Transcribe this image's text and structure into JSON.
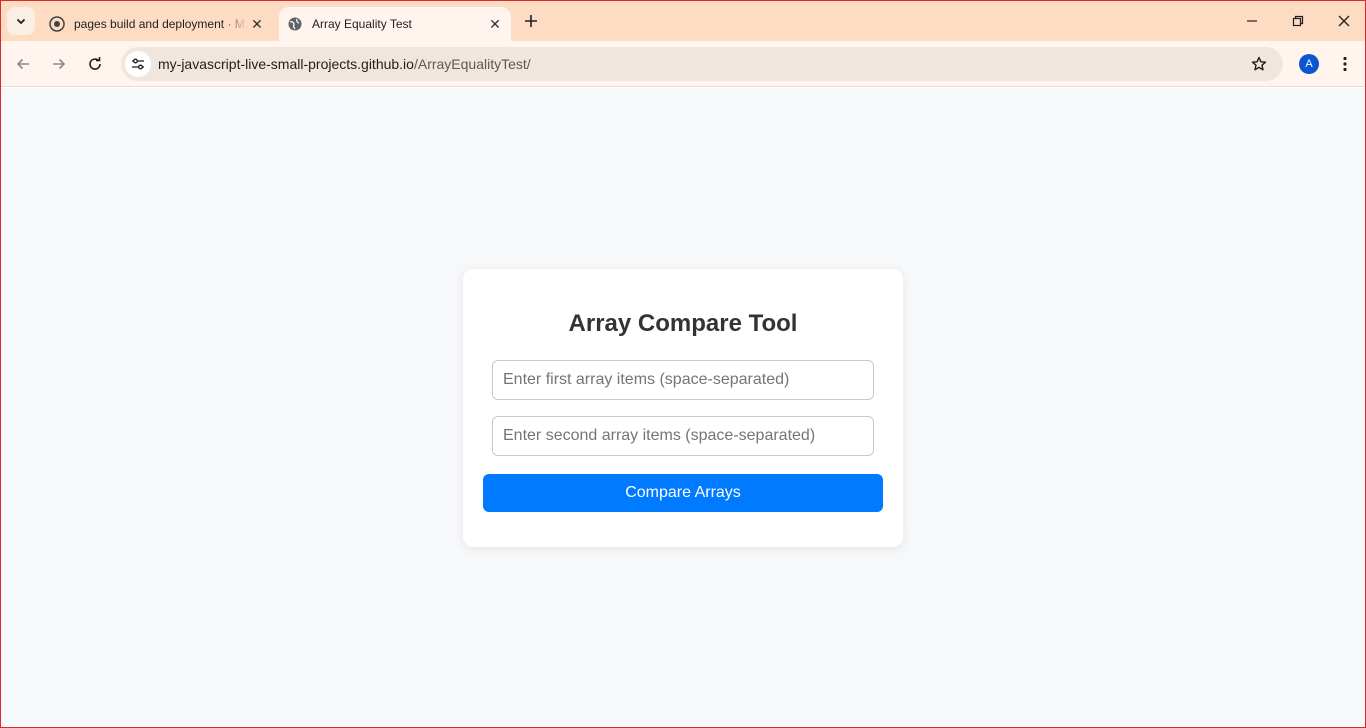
{
  "browser": {
    "tabs": [
      {
        "title": "pages build and deployment · M",
        "favicon": "github-icon",
        "active": false
      },
      {
        "title": "Array Equality Test",
        "favicon": "globe-icon",
        "active": true
      }
    ],
    "url_host": "my-javascript-live-small-projects.github.io",
    "url_path": "/ArrayEqualityTest/",
    "profile_initial": "A",
    "accent_color": "#0b57d0",
    "frame_color": "#fddcc3"
  },
  "app": {
    "heading": "Array Compare Tool",
    "first_input": {
      "value": "",
      "placeholder": "Enter first array items (space-separated)"
    },
    "second_input": {
      "value": "",
      "placeholder": "Enter second array items (space-separated)"
    },
    "compare_button": "Compare Arrays",
    "button_color": "#007bff",
    "background_color": "#f7f8fa"
  }
}
